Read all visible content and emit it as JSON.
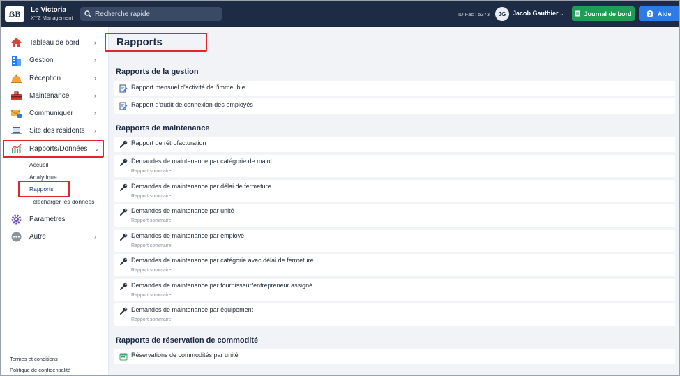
{
  "topbar": {
    "logo_text": "ẞB",
    "org_name": "Le Victoria",
    "org_sub": "XYZ Management",
    "search_placeholder": "Recherche rapide",
    "id_fac": "ID Fac : 5373",
    "avatar_initials": "JG",
    "user_name": "Jacob Gauthier",
    "journal_label": "Journal de bord",
    "aide_label": "Aide",
    "colors": {
      "bar": "#1d2b45",
      "journal": "#1f9d57",
      "aide": "#2d7be5"
    }
  },
  "sidebar": {
    "items": [
      {
        "label": "Tableau de bord",
        "icon": "house-icon"
      },
      {
        "label": "Gestion",
        "icon": "building-icon"
      },
      {
        "label": "Réception",
        "icon": "bell-icon"
      },
      {
        "label": "Maintenance",
        "icon": "toolbox-icon"
      },
      {
        "label": "Communiquer",
        "icon": "envelope-icon"
      },
      {
        "label": "Site des résidents",
        "icon": "laptop-icon"
      },
      {
        "label": "Rapports/Données",
        "icon": "bar-chart-icon"
      },
      {
        "label": "Paramètres",
        "icon": "gear-icon"
      },
      {
        "label": "Autre",
        "icon": "more-icon"
      }
    ],
    "subitems": [
      "Accueil",
      "Analytique",
      "Rapports",
      "Télécharger les données"
    ],
    "footer": [
      "Termes et conditions",
      "Politique de confidentialité"
    ]
  },
  "main": {
    "title": "Rapports",
    "sections": [
      {
        "title": "Rapports de la gestion",
        "rows": [
          {
            "title": "Rapport mensuel d'activité de l'immeuble",
            "icon": "document-edit-icon"
          },
          {
            "title": "Rapport d'audit de connexion des employés",
            "icon": "document-edit-icon"
          }
        ]
      },
      {
        "title": "Rapports de maintenance",
        "rows": [
          {
            "title": "Rapport de rétrofacturation",
            "icon": "wrench-icon"
          },
          {
            "title": "Demandes de maintenance par catégorie de maint",
            "sub": "Rapport sommaire",
            "icon": "wrench-icon"
          },
          {
            "title": "Demandes de maintenance par délai de fermeture",
            "sub": "Rapport sommaire",
            "icon": "wrench-icon"
          },
          {
            "title": "Demandes de maintenance par unité",
            "sub": "Rapport sommaire",
            "icon": "wrench-icon"
          },
          {
            "title": "Demandes de maintenance par employé",
            "sub": "Rapport sommaire",
            "icon": "wrench-icon"
          },
          {
            "title": "Demandes de maintenance par catégorie avec délai de fermeture",
            "sub": "Rapport sommaire",
            "icon": "wrench-icon"
          },
          {
            "title": "Demandes de maintenance par fournisseur/entrepreneur assigné",
            "sub": "Rapport sommaire",
            "icon": "wrench-icon"
          },
          {
            "title": "Demandes de maintenance par équipement",
            "sub": "Rapport sommaire",
            "icon": "wrench-icon"
          }
        ]
      },
      {
        "title": "Rapports de réservation de commodité",
        "rows": [
          {
            "title": "Réservations de commodités par unité",
            "icon": "calendar-icon"
          }
        ]
      }
    ]
  }
}
